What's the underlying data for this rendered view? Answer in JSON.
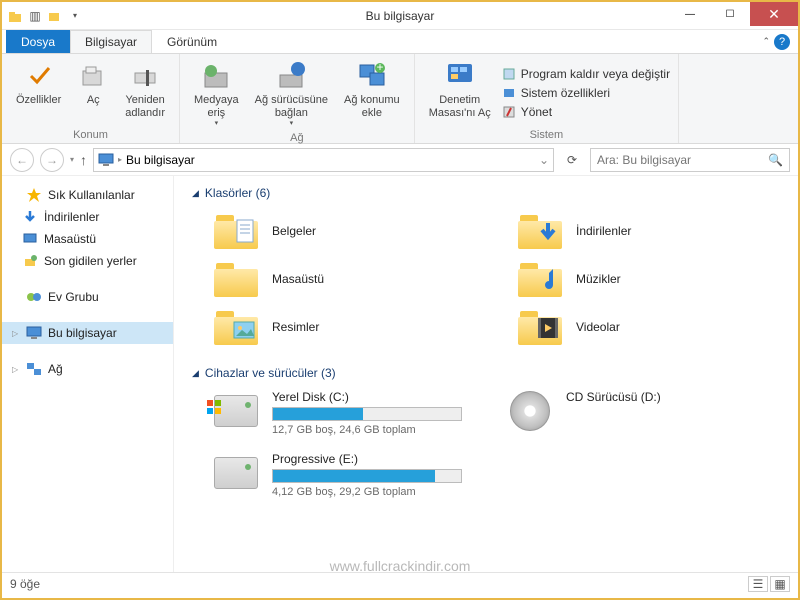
{
  "window": {
    "title": "Bu bilgisayar"
  },
  "tabs": {
    "file": "Dosya",
    "computer": "Bilgisayar",
    "view": "Görünüm"
  },
  "ribbon": {
    "group_location": "Konum",
    "group_network": "Ağ",
    "group_system": "Sistem",
    "properties": "Özellikler",
    "open": "Aç",
    "rename": "Yeniden\nadlandır",
    "media_access": "Medyaya\neriş",
    "map_drive": "Ağ sürücüsüne\nbağlan",
    "add_network": "Ağ konumu\nekle",
    "control_panel": "Denetim\nMasası'nı Aç",
    "uninstall": "Program kaldır veya değiştir",
    "sys_props": "Sistem özellikleri",
    "manage": "Yönet"
  },
  "nav": {
    "breadcrumb": "Bu bilgisayar",
    "search_placeholder": "Ara: Bu bilgisayar"
  },
  "sidebar": {
    "favorites": "Sık Kullanılanlar",
    "downloads": "İndirilenler",
    "desktop": "Masaüstü",
    "recent": "Son gidilen yerler",
    "homegroup": "Ev Grubu",
    "thispc": "Bu bilgisayar",
    "network": "Ağ"
  },
  "sections": {
    "folders_title": "Klasörler (6)",
    "drives_title": "Cihazlar ve sürücüler (3)"
  },
  "folders": [
    {
      "name": "Belgeler",
      "icon": "documents"
    },
    {
      "name": "İndirilenler",
      "icon": "downloads"
    },
    {
      "name": "Masaüstü",
      "icon": "desktop"
    },
    {
      "name": "Müzikler",
      "icon": "music"
    },
    {
      "name": "Resimler",
      "icon": "pictures"
    },
    {
      "name": "Videolar",
      "icon": "videos"
    }
  ],
  "drives": [
    {
      "name": "Yerel Disk (C:)",
      "free": "12,7 GB boş, 24,6 GB toplam",
      "fill_pct": 48,
      "type": "hdd",
      "os": true
    },
    {
      "name": "CD Sürücüsü (D:)",
      "type": "cd"
    },
    {
      "name": "Progressive (E:)",
      "free": "4,12 GB boş, 29,2 GB toplam",
      "fill_pct": 86,
      "type": "hdd"
    }
  ],
  "status": {
    "item_count": "9 öğe"
  },
  "watermark": "www.fullcrackindir.com"
}
